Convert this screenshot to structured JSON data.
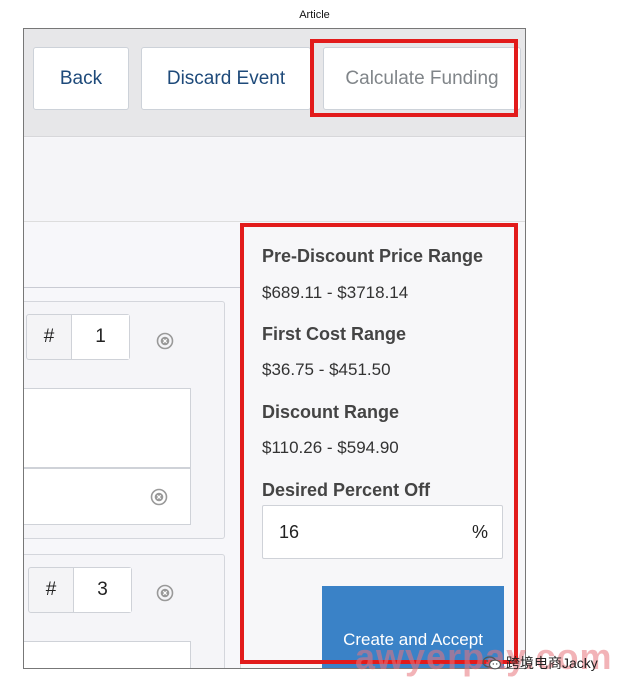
{
  "caption": "Article",
  "toolbar": {
    "back_label": "Back",
    "discard_label": "Discard Event",
    "calculate_label": "Calculate Funding"
  },
  "rows": [
    {
      "hash_symbol": "#",
      "quantity": "1"
    },
    {
      "hash_symbol": "#",
      "quantity": "3"
    }
  ],
  "summary": {
    "pre_discount_label": "Pre-Discount Price Range",
    "pre_discount_value": "$689.11 - $3718.14",
    "first_cost_label": "First Cost Range",
    "first_cost_value": "$36.75 - $451.50",
    "discount_label": "Discount Range",
    "discount_value": "$110.26 - $594.90",
    "percent_label": "Desired Percent Off",
    "percent_value": "16",
    "percent_symbol": "%"
  },
  "actions": {
    "create_accept_label": "Create and Accept"
  },
  "watermark": {
    "text": "awyerpay.com",
    "credit": "跨境电商Jacky"
  },
  "colors": {
    "highlight": "#e21b1b",
    "primary": "#3a82c7",
    "link_text": "#1e4a7a"
  },
  "icons": {
    "remove": "close-circle-icon",
    "wechat": "wechat-icon"
  }
}
